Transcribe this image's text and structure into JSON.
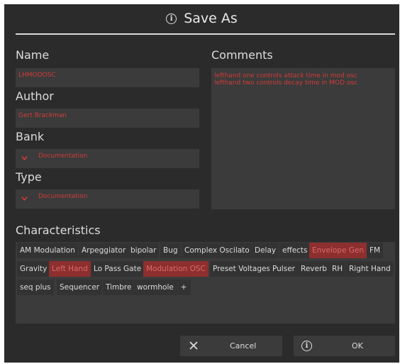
{
  "dialog": {
    "title": "Save As",
    "title_icon": "info-icon"
  },
  "form": {
    "name_label": "Name",
    "name_value": "LHMODOSC",
    "author_label": "Author",
    "author_value": "Gert Brackman",
    "bank_label": "Bank",
    "bank_value": "Documentation",
    "type_label": "Type",
    "type_value": "Documentation",
    "comments_label": "Comments",
    "comments_value": "lefthand one controls attack time in mod osc\nlefthand two controls decay time in MOD osc"
  },
  "characteristics": {
    "label": "Characteristics",
    "tags": [
      {
        "label": "AM Modulation",
        "selected": false
      },
      {
        "label": "Arpeggiator",
        "selected": false
      },
      {
        "label": "bipolar",
        "selected": false
      },
      {
        "label": "Bug",
        "selected": false
      },
      {
        "label": "Complex Oscilato",
        "selected": false
      },
      {
        "label": "Delay",
        "selected": false
      },
      {
        "label": "effects",
        "selected": false
      },
      {
        "label": "Envelope Gen",
        "selected": true
      },
      {
        "label": "FM",
        "selected": false
      },
      {
        "label": "Gravity",
        "selected": false
      },
      {
        "label": "Left Hand",
        "selected": true
      },
      {
        "label": "Lo Pass Gate",
        "selected": false
      },
      {
        "label": "Modulation OSC",
        "selected": true
      },
      {
        "label": "Preset Voltages",
        "selected": false
      },
      {
        "label": "Pulser",
        "selected": false
      },
      {
        "label": "Reverb",
        "selected": false
      },
      {
        "label": "RH",
        "selected": false
      },
      {
        "label": "Right Hand",
        "selected": false
      },
      {
        "label": "seq plus",
        "selected": false
      },
      {
        "label": "Sequencer",
        "selected": false
      },
      {
        "label": "Timbre",
        "selected": false
      },
      {
        "label": "wormhole",
        "selected": false
      },
      {
        "label": "+",
        "selected": false
      }
    ]
  },
  "buttons": {
    "cancel_label": "Cancel",
    "cancel_icon": "close-icon",
    "ok_label": "OK",
    "ok_icon": "info-icon"
  },
  "colors": {
    "background": "#2b2b2b",
    "field": "#3b3b3b",
    "accent_text": "#d23a3a",
    "selected_tag": "#8e2f2f"
  }
}
